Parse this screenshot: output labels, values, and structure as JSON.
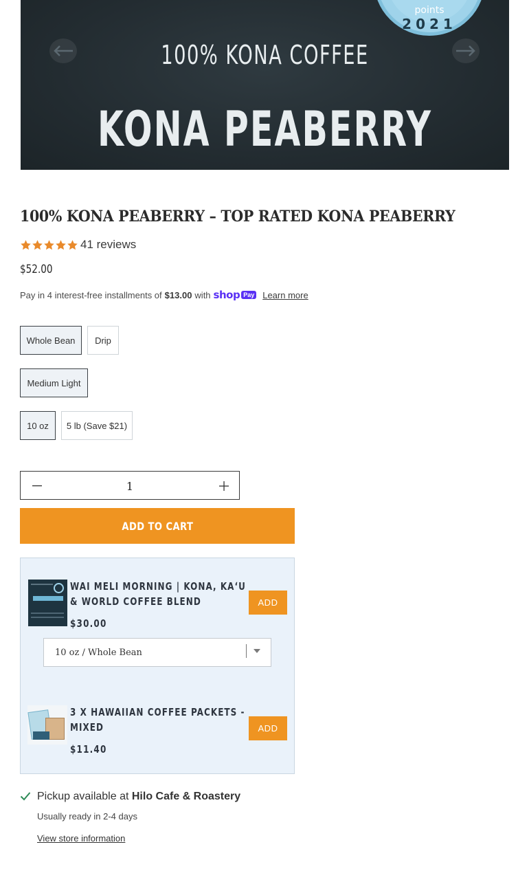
{
  "hero": {
    "badge_text": "points",
    "badge_year": "2021",
    "line1": "100% KONA COFFEE",
    "line2": "KONA PEABERRY",
    "prev_icon": "arrow-left-icon",
    "next_icon": "arrow-right-icon"
  },
  "product": {
    "title": "100% KONA PEABERRY – TOP RATED KONA PEABERRY",
    "rating": 5,
    "reviews": "41 reviews",
    "price": "$52.00",
    "installments": {
      "prefix": "Pay in 4 interest-free installments of",
      "amount": "$13.00",
      "suffix": "with",
      "brand_shop": "shop",
      "brand_pay": "Pay",
      "learn_more": "Learn more"
    }
  },
  "options": {
    "grind": [
      "Whole Bean",
      "Drip"
    ],
    "grind_selected": "Whole Bean",
    "roast": [
      "Medium Light"
    ],
    "roast_selected": "Medium Light",
    "size": [
      "10 oz",
      "5 lb (Save $21)"
    ],
    "size_selected": "10 oz"
  },
  "quantity": {
    "value": "1",
    "minus_icon": "minus-icon",
    "plus_icon": "plus-icon"
  },
  "add_to_cart": "ADD TO CART",
  "upsell": [
    {
      "title": "WAI MELI MORNING | KONA, KAʻU & WORLD COFFEE BLEND",
      "price": "$30.00",
      "add_label": "ADD",
      "variant": "10 oz / Whole Bean"
    },
    {
      "title": "3 X HAWAIIAN COFFEE PACKETS - MIXED",
      "price": "$11.40",
      "add_label": "ADD"
    }
  ],
  "pickup": {
    "prefix": "Pickup available at",
    "store": "Hilo Cafe & Roastery",
    "ready": "Usually ready in 2-4 days",
    "link": "View store information"
  },
  "colors": {
    "accent": "#ef9421",
    "shop_pay": "#5a31f4",
    "check": "#2e8b57"
  }
}
